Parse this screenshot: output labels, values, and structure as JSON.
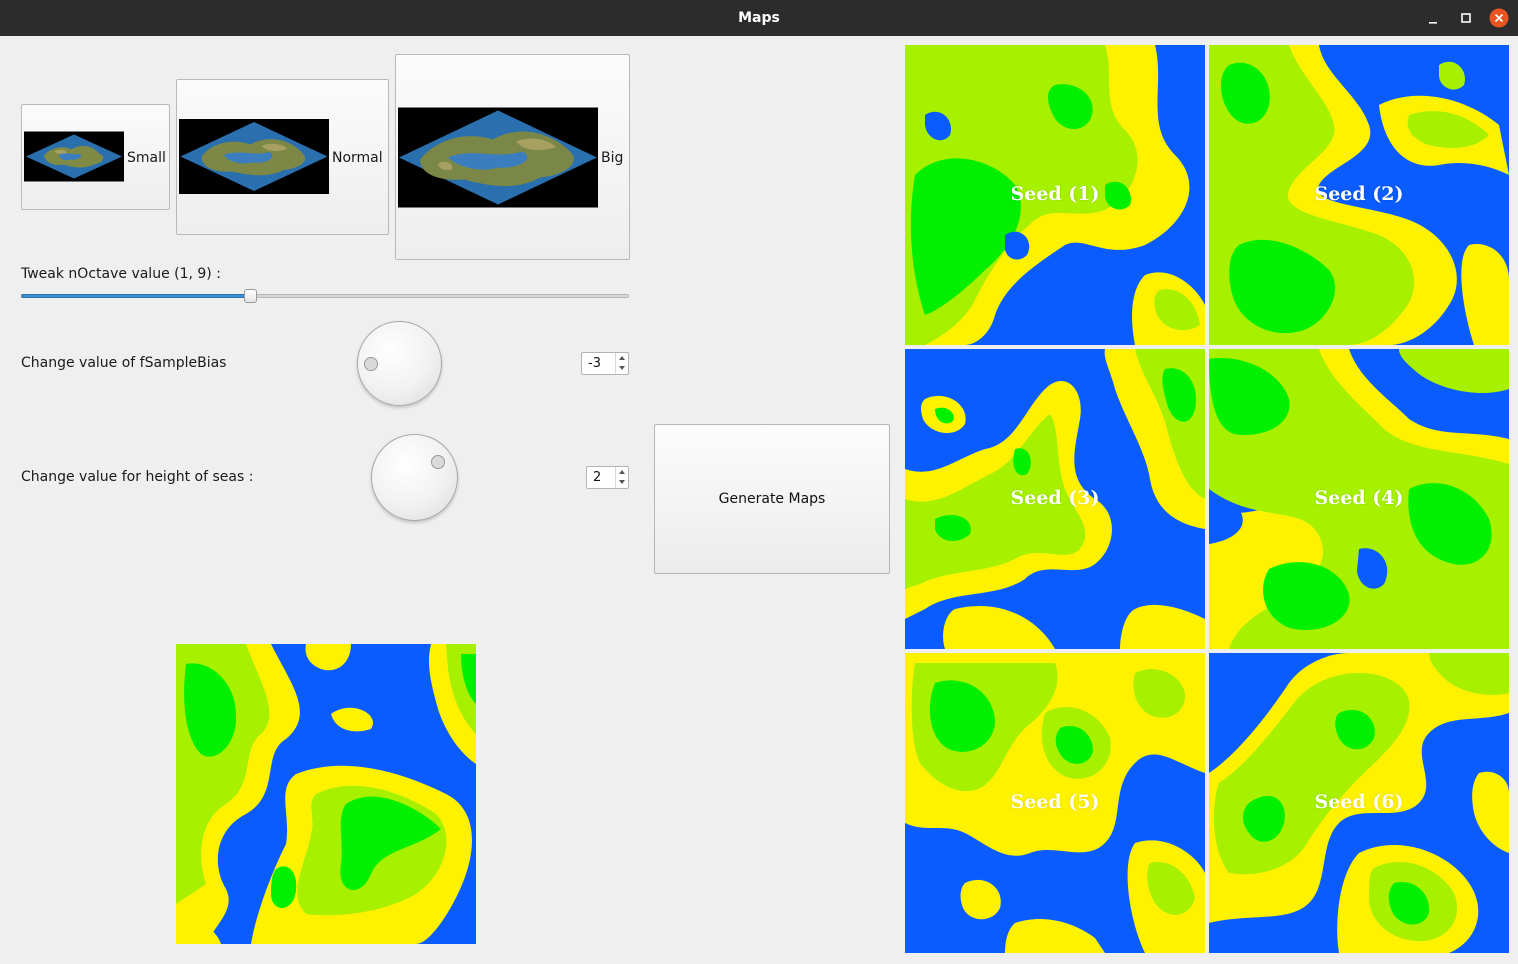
{
  "window": {
    "title": "Maps"
  },
  "map_sizes": [
    {
      "label": "Small",
      "thumbnail": "isometric-map-thumbnail"
    },
    {
      "label": "Normal",
      "thumbnail": "isometric-map-thumbnail"
    },
    {
      "label": "Big",
      "thumbnail": "isometric-map-thumbnail"
    }
  ],
  "octave": {
    "label": "Tweak nOctave value (1, 9) :",
    "min": 1,
    "max": 9,
    "value": 4
  },
  "sample_bias": {
    "label": "Change value of fSampleBias",
    "value": "-3"
  },
  "sea_height": {
    "label": "Change value for height of seas :",
    "value": "2"
  },
  "generate_button": {
    "label": "Generate Maps"
  },
  "seeds": [
    {
      "label": "Seed (1)"
    },
    {
      "label": "Seed (2)"
    },
    {
      "label": "Seed (3)"
    },
    {
      "label": "Seed (4)"
    },
    {
      "label": "Seed (5)"
    },
    {
      "label": "Seed (6)"
    }
  ],
  "colors": {
    "sea": "#0a5cff",
    "sand": "#fff200",
    "lowland": "#a6f000",
    "forest": "#00f000",
    "slider_accent": "#3d8ed0"
  },
  "icons": {
    "minimize": "minimize-icon",
    "maximize": "maximize-icon",
    "close": "close-icon"
  }
}
